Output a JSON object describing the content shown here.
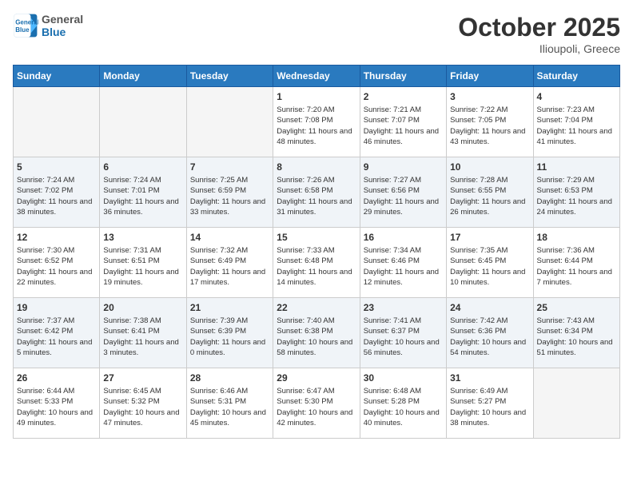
{
  "header": {
    "logo_line1": "General",
    "logo_line2": "Blue",
    "title": "October 2025",
    "subtitle": "Ilioupoli, Greece"
  },
  "days_of_week": [
    "Sunday",
    "Monday",
    "Tuesday",
    "Wednesday",
    "Thursday",
    "Friday",
    "Saturday"
  ],
  "weeks": [
    [
      {
        "day": "",
        "info": ""
      },
      {
        "day": "",
        "info": ""
      },
      {
        "day": "",
        "info": ""
      },
      {
        "day": "1",
        "info": "Sunrise: 7:20 AM\nSunset: 7:08 PM\nDaylight: 11 hours and 48 minutes."
      },
      {
        "day": "2",
        "info": "Sunrise: 7:21 AM\nSunset: 7:07 PM\nDaylight: 11 hours and 46 minutes."
      },
      {
        "day": "3",
        "info": "Sunrise: 7:22 AM\nSunset: 7:05 PM\nDaylight: 11 hours and 43 minutes."
      },
      {
        "day": "4",
        "info": "Sunrise: 7:23 AM\nSunset: 7:04 PM\nDaylight: 11 hours and 41 minutes."
      }
    ],
    [
      {
        "day": "5",
        "info": "Sunrise: 7:24 AM\nSunset: 7:02 PM\nDaylight: 11 hours and 38 minutes."
      },
      {
        "day": "6",
        "info": "Sunrise: 7:24 AM\nSunset: 7:01 PM\nDaylight: 11 hours and 36 minutes."
      },
      {
        "day": "7",
        "info": "Sunrise: 7:25 AM\nSunset: 6:59 PM\nDaylight: 11 hours and 33 minutes."
      },
      {
        "day": "8",
        "info": "Sunrise: 7:26 AM\nSunset: 6:58 PM\nDaylight: 11 hours and 31 minutes."
      },
      {
        "day": "9",
        "info": "Sunrise: 7:27 AM\nSunset: 6:56 PM\nDaylight: 11 hours and 29 minutes."
      },
      {
        "day": "10",
        "info": "Sunrise: 7:28 AM\nSunset: 6:55 PM\nDaylight: 11 hours and 26 minutes."
      },
      {
        "day": "11",
        "info": "Sunrise: 7:29 AM\nSunset: 6:53 PM\nDaylight: 11 hours and 24 minutes."
      }
    ],
    [
      {
        "day": "12",
        "info": "Sunrise: 7:30 AM\nSunset: 6:52 PM\nDaylight: 11 hours and 22 minutes."
      },
      {
        "day": "13",
        "info": "Sunrise: 7:31 AM\nSunset: 6:51 PM\nDaylight: 11 hours and 19 minutes."
      },
      {
        "day": "14",
        "info": "Sunrise: 7:32 AM\nSunset: 6:49 PM\nDaylight: 11 hours and 17 minutes."
      },
      {
        "day": "15",
        "info": "Sunrise: 7:33 AM\nSunset: 6:48 PM\nDaylight: 11 hours and 14 minutes."
      },
      {
        "day": "16",
        "info": "Sunrise: 7:34 AM\nSunset: 6:46 PM\nDaylight: 11 hours and 12 minutes."
      },
      {
        "day": "17",
        "info": "Sunrise: 7:35 AM\nSunset: 6:45 PM\nDaylight: 11 hours and 10 minutes."
      },
      {
        "day": "18",
        "info": "Sunrise: 7:36 AM\nSunset: 6:44 PM\nDaylight: 11 hours and 7 minutes."
      }
    ],
    [
      {
        "day": "19",
        "info": "Sunrise: 7:37 AM\nSunset: 6:42 PM\nDaylight: 11 hours and 5 minutes."
      },
      {
        "day": "20",
        "info": "Sunrise: 7:38 AM\nSunset: 6:41 PM\nDaylight: 11 hours and 3 minutes."
      },
      {
        "day": "21",
        "info": "Sunrise: 7:39 AM\nSunset: 6:39 PM\nDaylight: 11 hours and 0 minutes."
      },
      {
        "day": "22",
        "info": "Sunrise: 7:40 AM\nSunset: 6:38 PM\nDaylight: 10 hours and 58 minutes."
      },
      {
        "day": "23",
        "info": "Sunrise: 7:41 AM\nSunset: 6:37 PM\nDaylight: 10 hours and 56 minutes."
      },
      {
        "day": "24",
        "info": "Sunrise: 7:42 AM\nSunset: 6:36 PM\nDaylight: 10 hours and 54 minutes."
      },
      {
        "day": "25",
        "info": "Sunrise: 7:43 AM\nSunset: 6:34 PM\nDaylight: 10 hours and 51 minutes."
      }
    ],
    [
      {
        "day": "26",
        "info": "Sunrise: 6:44 AM\nSunset: 5:33 PM\nDaylight: 10 hours and 49 minutes."
      },
      {
        "day": "27",
        "info": "Sunrise: 6:45 AM\nSunset: 5:32 PM\nDaylight: 10 hours and 47 minutes."
      },
      {
        "day": "28",
        "info": "Sunrise: 6:46 AM\nSunset: 5:31 PM\nDaylight: 10 hours and 45 minutes."
      },
      {
        "day": "29",
        "info": "Sunrise: 6:47 AM\nSunset: 5:30 PM\nDaylight: 10 hours and 42 minutes."
      },
      {
        "day": "30",
        "info": "Sunrise: 6:48 AM\nSunset: 5:28 PM\nDaylight: 10 hours and 40 minutes."
      },
      {
        "day": "31",
        "info": "Sunrise: 6:49 AM\nSunset: 5:27 PM\nDaylight: 10 hours and 38 minutes."
      },
      {
        "day": "",
        "info": ""
      }
    ]
  ]
}
